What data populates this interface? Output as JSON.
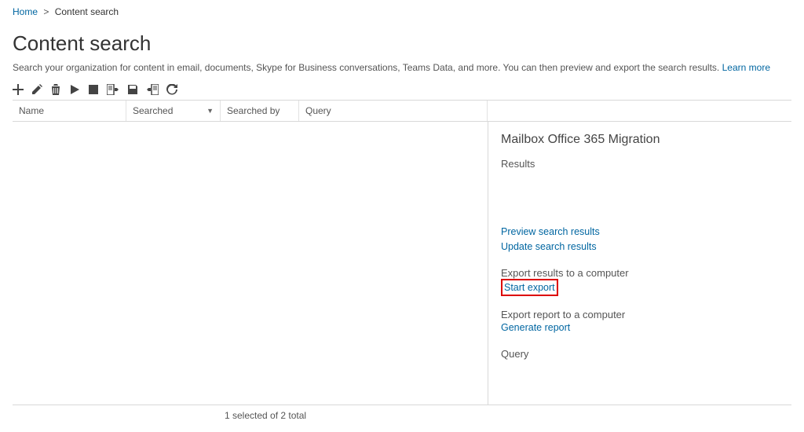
{
  "breadcrumb": {
    "home": "Home",
    "sep": ">",
    "current": "Content search"
  },
  "page": {
    "title": "Content search",
    "subtitle": "Search your organization for content in email, documents, Skype for Business conversations, Teams Data, and more. You can then preview and export the search results.",
    "learn_more": "Learn more"
  },
  "toolbar": {
    "add": "add-icon",
    "edit": "pencil-icon",
    "delete": "trash-icon",
    "play": "play-icon",
    "stop": "stop-icon",
    "export1": "doc-right-icon",
    "export2": "save-icon",
    "export3": "doc-left-icon",
    "refresh": "refresh-icon"
  },
  "columns": {
    "name": "Name",
    "searched": "Searched",
    "by": "Searched by",
    "query": "Query"
  },
  "details": {
    "title": "Mailbox Office 365 Migration",
    "results_label": "Results",
    "preview_link": "Preview search results",
    "update_link": "Update search results",
    "export_results_label": "Export results to a computer",
    "start_export_link": "Start export",
    "export_report_label": "Export report to a computer",
    "generate_report_link": "Generate report",
    "query_label": "Query"
  },
  "status": "1 selected of 2 total"
}
